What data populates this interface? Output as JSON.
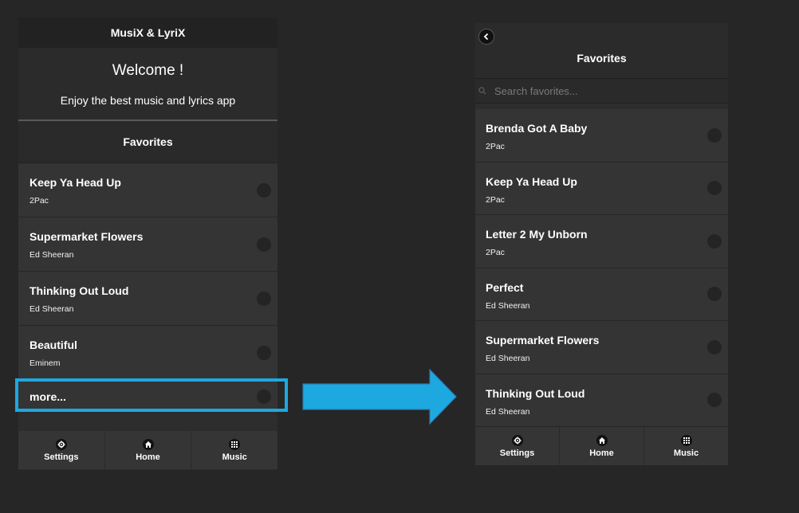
{
  "left": {
    "app_title": "MusiX & LyriX",
    "welcome_title": "Welcome !",
    "welcome_subtitle": "Enjoy the best music and lyrics app",
    "section_title": "Favorites",
    "items": [
      {
        "title": "Keep Ya Head Up",
        "artist": "2Pac"
      },
      {
        "title": "Supermarket Flowers",
        "artist": "Ed Sheeran"
      },
      {
        "title": "Thinking Out Loud",
        "artist": "Ed Sheeran"
      },
      {
        "title": "Beautiful",
        "artist": "Eminem"
      }
    ],
    "more_label": "more..."
  },
  "right": {
    "title": "Favorites",
    "search_placeholder": "Search favorites...",
    "items": [
      {
        "title": "Brenda Got A Baby",
        "artist": "2Pac"
      },
      {
        "title": "Keep Ya Head Up",
        "artist": "2Pac"
      },
      {
        "title": "Letter 2 My Unborn",
        "artist": "2Pac"
      },
      {
        "title": "Perfect",
        "artist": "Ed Sheeran"
      },
      {
        "title": "Supermarket Flowers",
        "artist": "Ed Sheeran"
      },
      {
        "title": "Thinking Out Loud",
        "artist": "Ed Sheeran"
      }
    ]
  },
  "tabs": {
    "settings": "Settings",
    "home": "Home",
    "music": "Music"
  },
  "colors": {
    "highlight": "#1ea8e0",
    "background": "#262626"
  }
}
